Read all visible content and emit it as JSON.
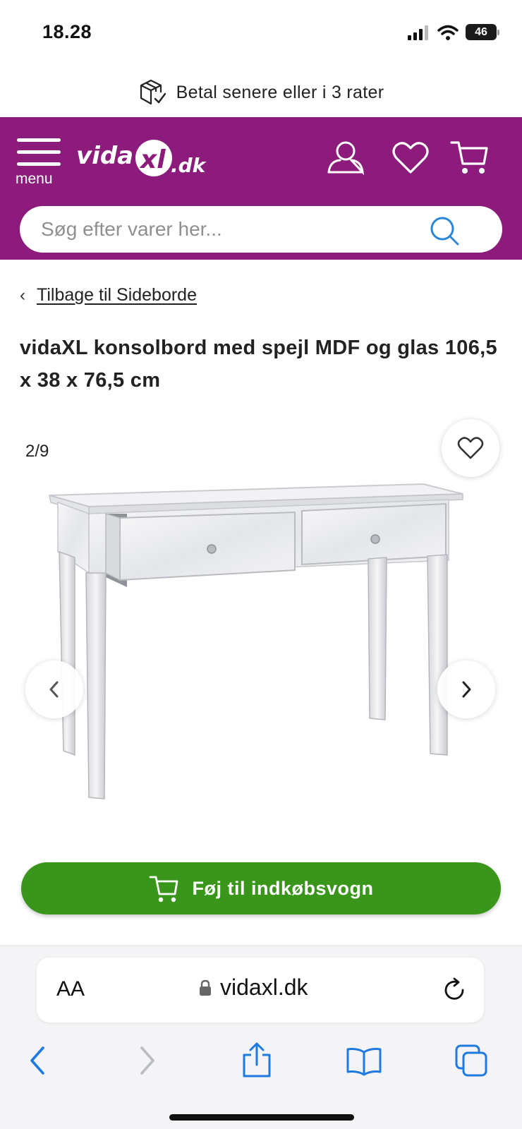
{
  "status": {
    "time": "18.28",
    "battery": "46"
  },
  "promo": {
    "text": "Betal senere eller i 3 rater"
  },
  "header": {
    "menu_label": "menu",
    "logo_text": "vidaXL.dk",
    "search_placeholder": "Søg efter varer her...",
    "brand_color": "#8c1b7c"
  },
  "breadcrumb": {
    "label": "Tilbage til Sideborde"
  },
  "product": {
    "title": "vidaXL konsolbord med spejl MDF og glas 106,5 x 38 x 76,5 cm",
    "image_counter": "2/9"
  },
  "cart_button": {
    "label": "Føj til indkøbsvogn",
    "color": "#3a961b"
  },
  "browser": {
    "text_size_label": "AA",
    "url": "vidaxl.dk"
  },
  "icons": [
    "box-check-icon",
    "menu-icon",
    "user-icon",
    "heart-icon",
    "cart-icon",
    "search-icon",
    "chevron-left-icon",
    "chevron-right-icon",
    "lock-icon",
    "reload-icon",
    "share-icon",
    "bookmarks-icon",
    "tabs-icon"
  ]
}
